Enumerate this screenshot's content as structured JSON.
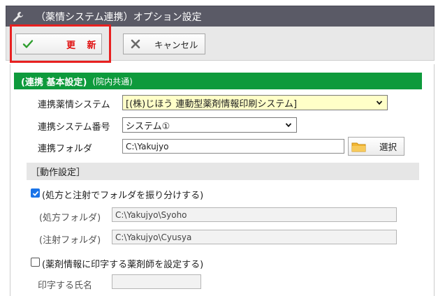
{
  "window": {
    "title": "（薬情システム連携）オプション設定",
    "icon": "wrench-icon"
  },
  "toolbar": {
    "update_label": "更 新",
    "cancel_label": "キャンセル"
  },
  "section": {
    "title": "(連携 基本設定)",
    "scope": "(院内共通)"
  },
  "form": {
    "system_label": "連携薬情システム",
    "system_value": "[(株)じほう 連動型薬剤情報印刷システム]",
    "number_label": "連携システム番号",
    "number_value": "システム①",
    "folder_label": "連携フォルダ",
    "folder_value": "C:\\Yakujyo",
    "select_label": "選択"
  },
  "behavior": {
    "heading": "［動作設定］",
    "split_label": "(処方と注射でフォルダを振り分けする)",
    "split_checked": true,
    "rx_folder_label": "(処方フォルダ)",
    "rx_folder_value": "C:\\Yakujyo\\Syoho",
    "inj_folder_label": "(注射フォルダ)",
    "inj_folder_value": "C:\\Yakujyo\\Cyusya",
    "pharmacist_label": "(薬剤情報に印字する薬剤師を設定する)",
    "pharmacist_checked": false,
    "print_name_label": "印字する氏名",
    "print_name_value": ""
  },
  "colors": {
    "title_bar": "#5a5a66",
    "section_green": "#0e9a3c",
    "highlight_red": "#e82020",
    "update_text": "#e01010"
  }
}
